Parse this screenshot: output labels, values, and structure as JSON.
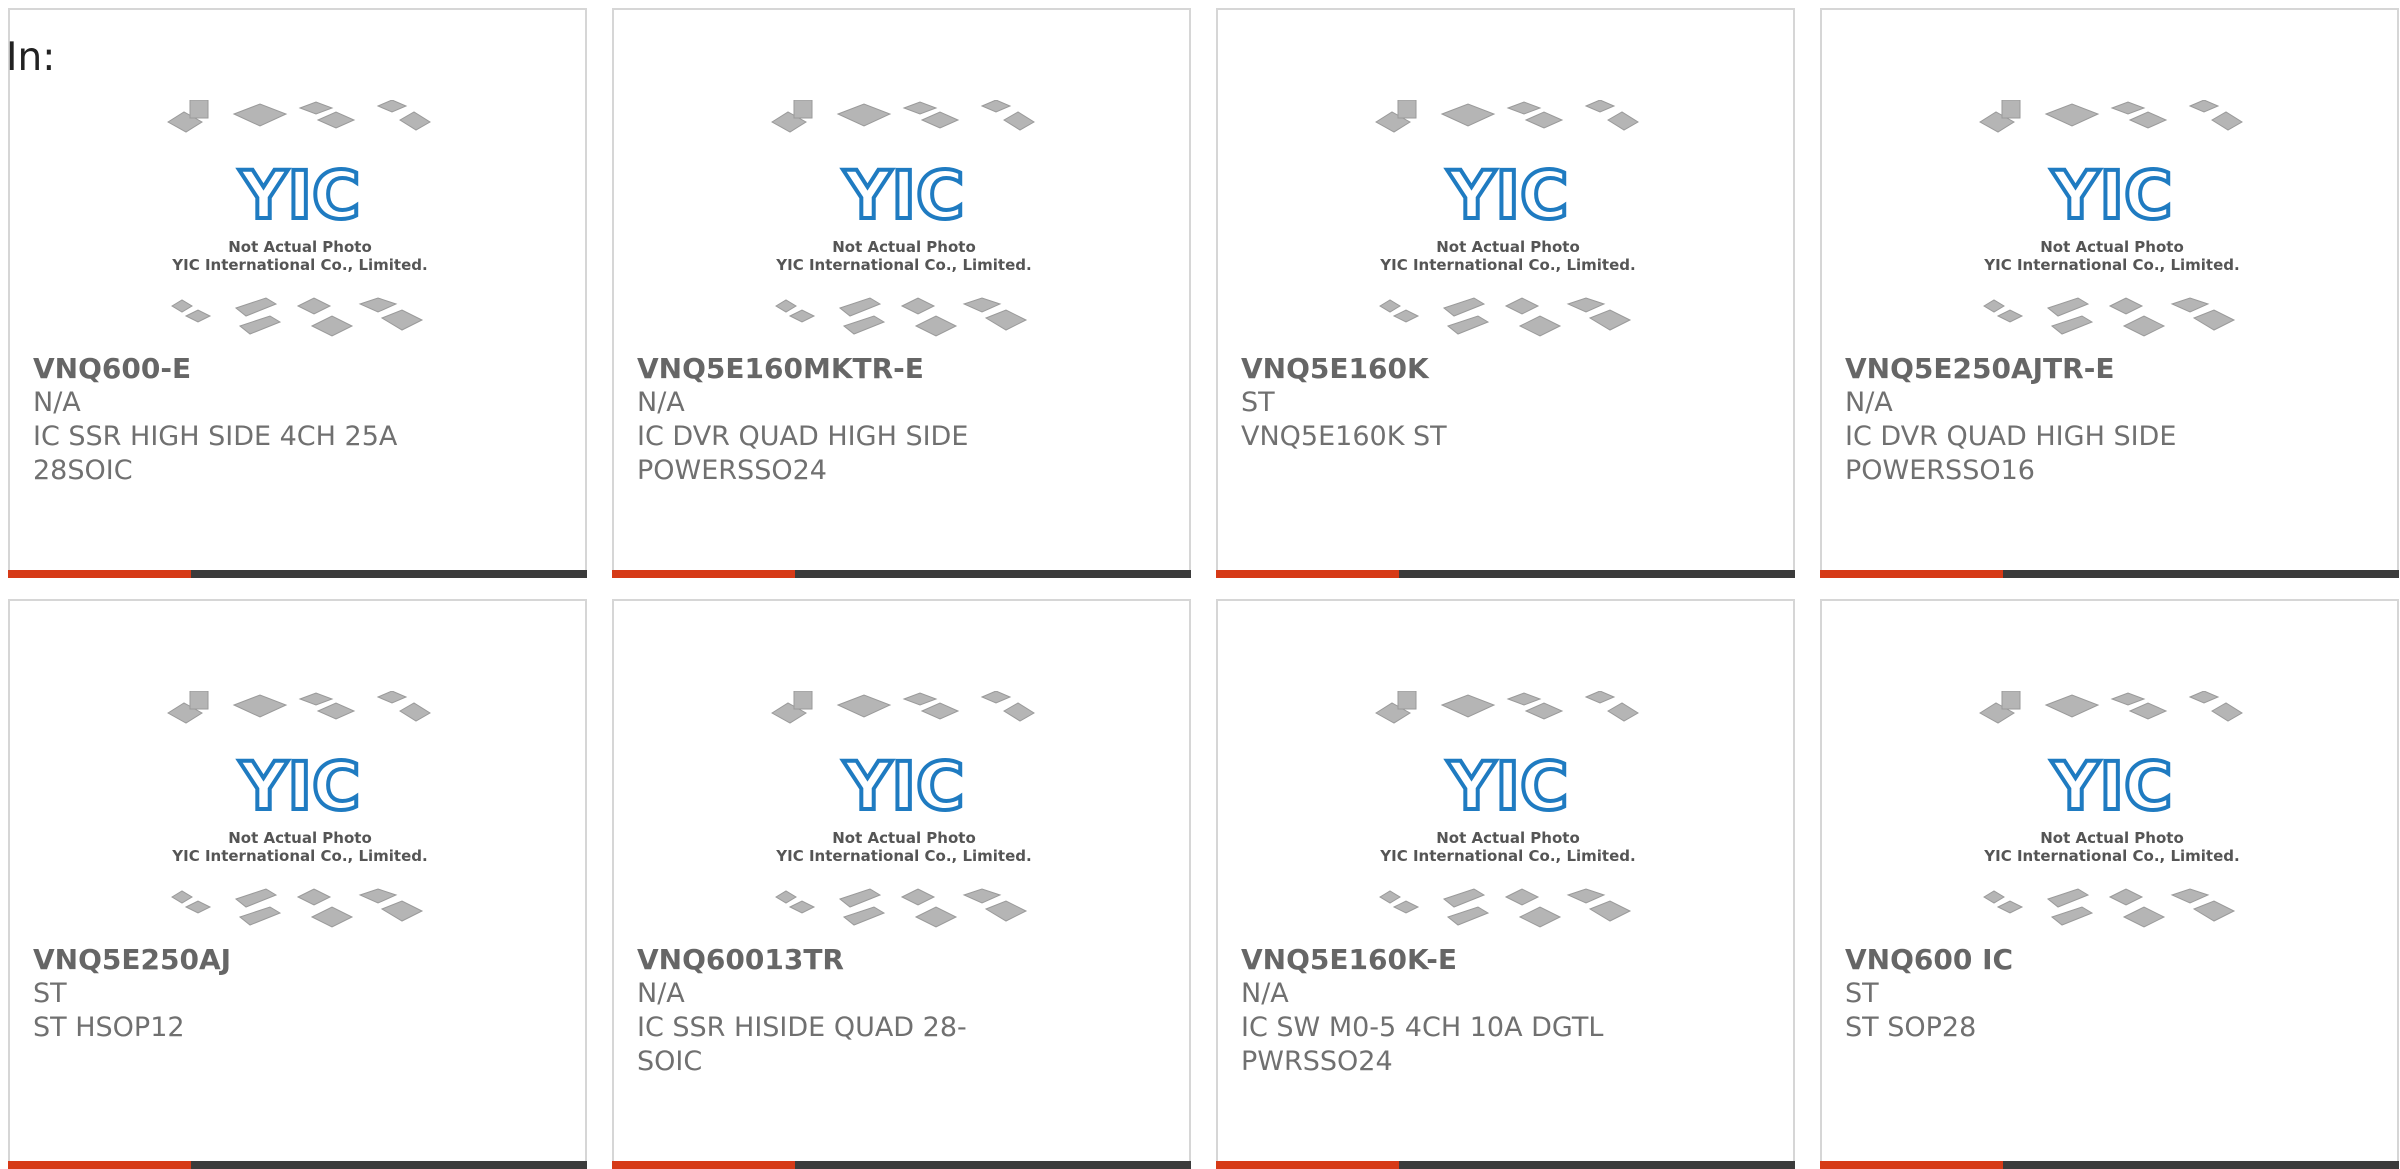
{
  "page": {
    "in_label": "In:"
  },
  "placeholder": {
    "line1": "Not Actual Photo",
    "line2": "YIC International Co., Limited.",
    "logo_text": "YIC",
    "logo_color": "#1f7bc1",
    "chip_color": "#b5b5b5"
  },
  "accent_color": "#d63a17",
  "bar_color": "#3b3b3b",
  "products": [
    {
      "part": "VNQ600-E",
      "maker": "N/A",
      "desc": "IC SSR HIGH SIDE 4CH 25A 28SOIC"
    },
    {
      "part": "VNQ5E160MKTR-E",
      "maker": "N/A",
      "desc": "IC DVR QUAD HIGH SIDE POWERSSO24"
    },
    {
      "part": "VNQ5E160K",
      "maker": "ST",
      "desc": "VNQ5E160K ST"
    },
    {
      "part": "VNQ5E250AJTR-E",
      "maker": "N/A",
      "desc": "IC DVR QUAD HIGH SIDE POWERSSO16"
    },
    {
      "part": "VNQ5E250AJ",
      "maker": "ST",
      "desc": "ST HSOP12"
    },
    {
      "part": "VNQ60013TR",
      "maker": "N/A",
      "desc": "IC SSR HISIDE QUAD 28-SOIC"
    },
    {
      "part": "VNQ5E160K-E",
      "maker": "N/A",
      "desc": "IC SW M0-5 4CH 10A DGTL PWRSSO24"
    },
    {
      "part": "VNQ600 IC",
      "maker": "ST",
      "desc": "ST SOP28"
    }
  ]
}
